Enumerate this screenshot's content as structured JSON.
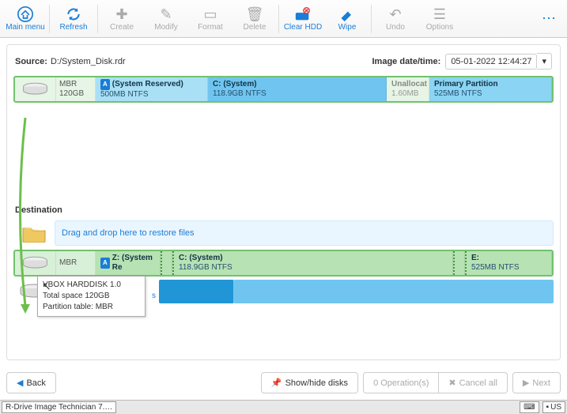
{
  "toolbar": {
    "main_menu": "Main menu",
    "refresh": "Refresh",
    "create": "Create",
    "modify": "Modify",
    "format": "Format",
    "delete": "Delete",
    "clear_hdd": "Clear HDD",
    "wipe": "Wipe",
    "undo": "Undo",
    "options": "Options"
  },
  "source": {
    "label": "Source:",
    "path": "D:/System_Disk.rdr",
    "dt_label": "Image date/time:",
    "dt_value": "05-01-2022 12:44:27"
  },
  "src_disk": {
    "type": "MBR",
    "size": "120GB",
    "parts": [
      {
        "badge": "A",
        "title": "(System Reserved)",
        "sub": "500MB NTFS"
      },
      {
        "title": "C: (System)",
        "sub": "118.9GB NTFS"
      },
      {
        "title": "Unallocat",
        "sub": "1.60MB"
      },
      {
        "title": "Primary Partition",
        "sub": "525MB NTFS"
      }
    ]
  },
  "dest_label": "Destination",
  "drop_hint": "Drag and drop here to restore files",
  "dest_disk": {
    "type": "MBR",
    "parts": [
      {
        "badge": "A",
        "title": "Z: (System Re",
        "sub": ""
      },
      {
        "title": "C: (System)",
        "sub": "118.9GB NTFS"
      },
      {
        "title": "E:",
        "sub": "525MB NTFS"
      }
    ]
  },
  "tooltip": {
    "line1": "VBOX HARDDISK 1.0",
    "line2": "Total space  120GB",
    "line3": "Partition table: MBR"
  },
  "footer": {
    "back": "Back",
    "showhide": "Show/hide disks",
    "ops": "0 Operation(s)",
    "cancel": "Cancel all",
    "next": "Next"
  },
  "taskbar": {
    "app": "R-Drive Image Technician 7.…",
    "lang": "US"
  },
  "extra_marker": "s"
}
